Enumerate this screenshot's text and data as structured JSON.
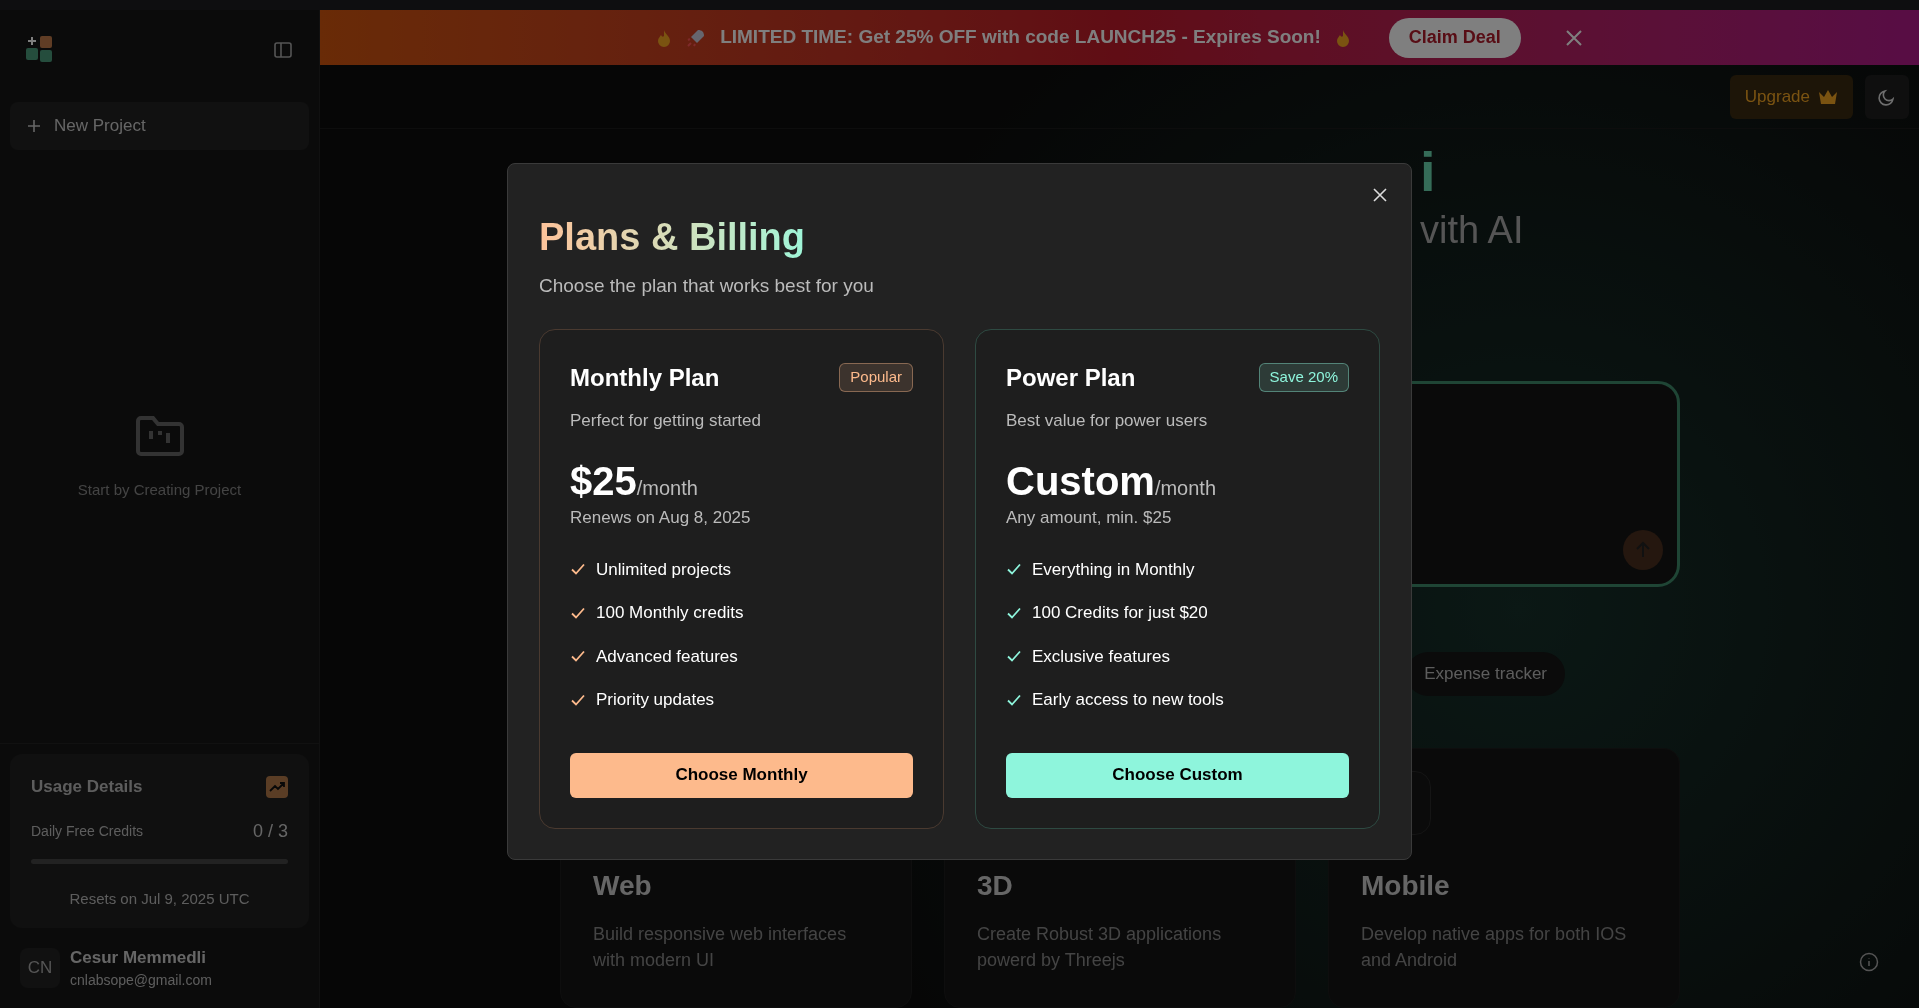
{
  "banner": {
    "text": "LIMITED TIME: Get 25% OFF with code LAUNCH25 - Expires Soon!",
    "button": "Claim Deal"
  },
  "sidebar": {
    "new_project": "New Project",
    "empty_state": "Start by Creating Project",
    "usage": {
      "title": "Usage Details",
      "label": "Daily Free Credits",
      "value": "0 / 3",
      "level": 0,
      "reset": "Resets on Jul 9, 2025 UTC"
    },
    "user": {
      "initials": "CN",
      "name": "Cesur Memmedli",
      "email": "cnlabsope@gmail.com"
    }
  },
  "header": {
    "upgrade": "Upgrade"
  },
  "hero": {
    "title": "i",
    "subtitle": "vith AI"
  },
  "suggestions": [
    "Expense tracker"
  ],
  "categories": [
    {
      "title": "Web",
      "description": "Build responsive web interfaces with modern UI"
    },
    {
      "title": "3D",
      "description": "Create Robust 3D applications powerd by Threejs"
    },
    {
      "title": "Mobile",
      "description": "Develop native apps for both IOS and Android"
    }
  ],
  "modal": {
    "title": "Plans & Billing",
    "subtitle": "Choose the plan that works best for you",
    "plans": [
      {
        "name": "Monthly Plan",
        "badge": "Popular",
        "description": "Perfect for getting started",
        "price": "$25",
        "period": "/month",
        "note": "Renews on Aug 8, 2025",
        "features": [
          "Unlimited projects",
          "100 Monthly credits",
          "Advanced features",
          "Priority updates"
        ],
        "button": "Choose Monthly",
        "color": "#fdba8c"
      },
      {
        "name": "Power Plan",
        "badge": "Save 20%",
        "description": "Best value for power users",
        "price": "Custom",
        "period": "/month",
        "note": "Any amount, min. $25",
        "features": [
          "Everything in Monthly",
          "100 Credits for just $20",
          "Exclusive features",
          "Early access to new tools"
        ],
        "button": "Choose Custom",
        "color": "#8ef5dc"
      }
    ]
  }
}
